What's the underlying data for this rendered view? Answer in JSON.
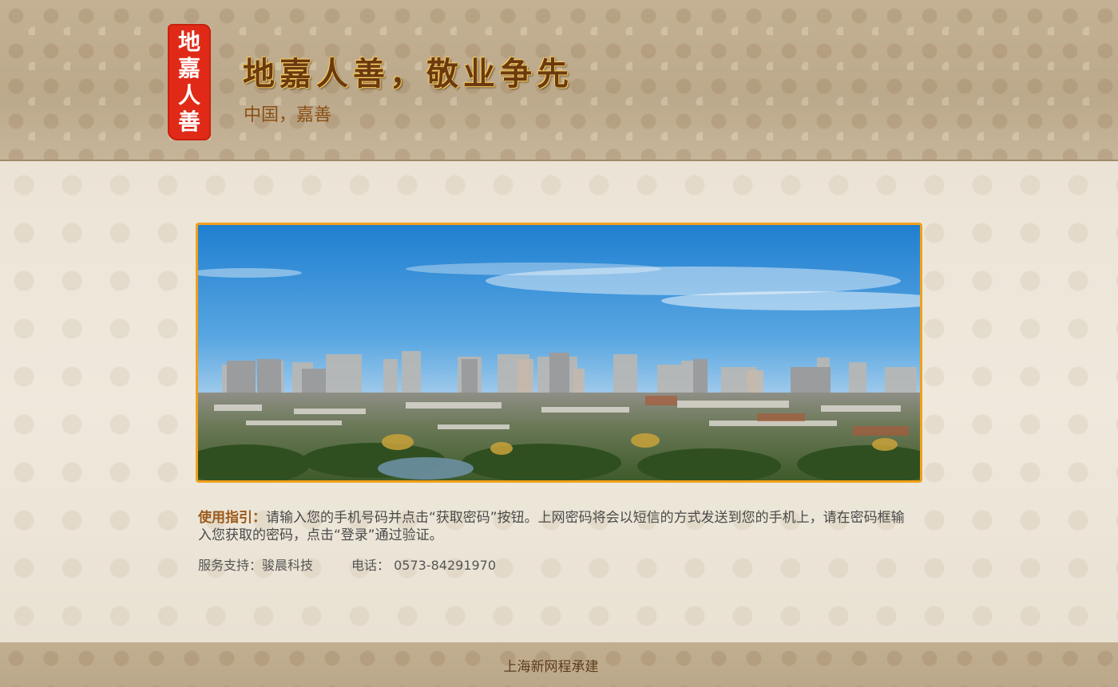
{
  "header": {
    "seal_chars": [
      "地",
      "嘉",
      "人",
      "善"
    ],
    "slogan": "地嘉人善，敬业争先",
    "subslogan": "中国，嘉善"
  },
  "guide": {
    "label": "使用指引：",
    "text": "请输入您的手机号码并点击“获取密码”按钮。上网密码将会以短信的方式发送到您的手机上，请在密码框输入您获取的密码，点击“登录”通过验证。"
  },
  "support": {
    "service": "服务支持：骏晨科技",
    "phone": "电话： 0573-84291970"
  },
  "footer": {
    "text": "上海新网程承建"
  },
  "colors": {
    "banner_border": "#f1a01c",
    "seal_red": "#e02a17",
    "slogan_brown": "#6b3a10"
  }
}
